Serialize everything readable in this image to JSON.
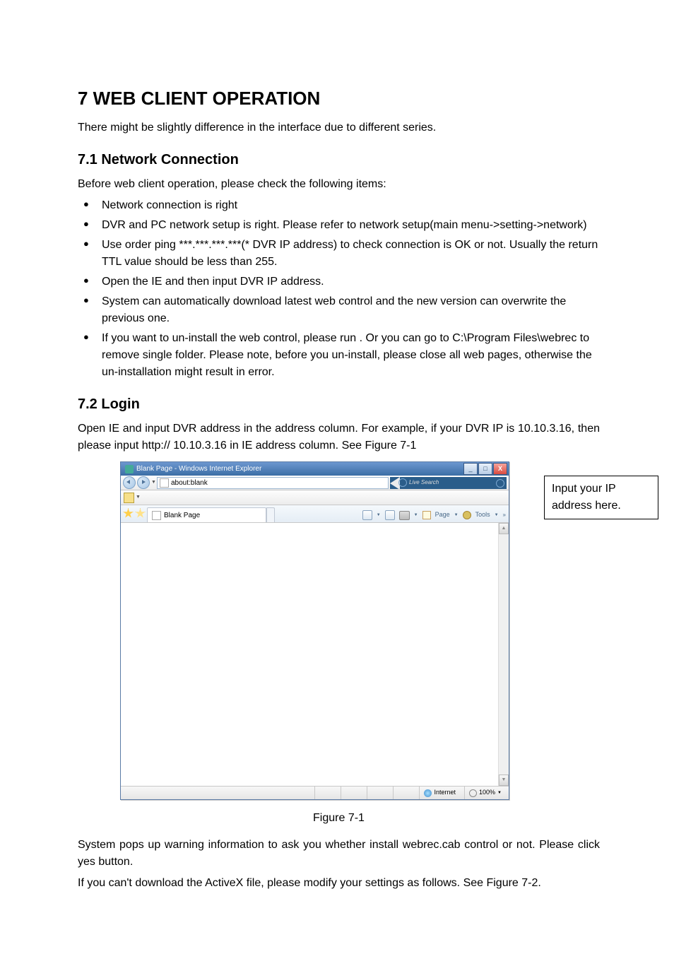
{
  "heading": {
    "h1": "7  WEB CLIENT OPERATION",
    "intro": "There might be slightly difference in the interface due to different series.",
    "h2_1": "7.1  Network Connection",
    "p_before_list": "Before web client operation, please check the following items:",
    "bullets": [
      "Network connection is right",
      "DVR and PC network setup is right. Please refer to network setup(main menu->setting->network)",
      "Use order ping ***.***.***.***(* DVR IP address) to check connection is OK or not. Usually the return TTL value should be less than 255.",
      "Open the IE and then input DVR IP address.",
      "System can automatically download latest web control and the new version can overwrite the previous one.",
      "If you want to un-install the web control, please run                                   . Or you can go to C:\\Program Files\\webrec to remove single folder. Please note, before you un-install, please close all web pages, otherwise the un-installation might result in error."
    ],
    "h2_2": "7.2  Login",
    "login_para": "Open IE and input DVR address in the address column. For example, if your DVR IP is 10.10.3.16, then please input http:// 10.10.3.16 in IE address column. See Figure 7-1"
  },
  "figure": {
    "window_title": "Blank Page - Windows Internet Explorer",
    "address_value": "about:blank",
    "search_placeholder": "Live Search",
    "tab_label": "Blank Page",
    "cmd_page": "Page",
    "cmd_tools": "Tools",
    "status_zone": "Internet",
    "status_zoom": "100%",
    "caption": "Figure 7-1",
    "annotation": "Input your IP address here."
  },
  "after_figure": {
    "p1": "System pops up warning information to ask you whether install webrec.cab control or not. Please click yes button.",
    "p2": "If you can't download the ActiveX file, please modify your settings as follows. See Figure 7-2."
  }
}
